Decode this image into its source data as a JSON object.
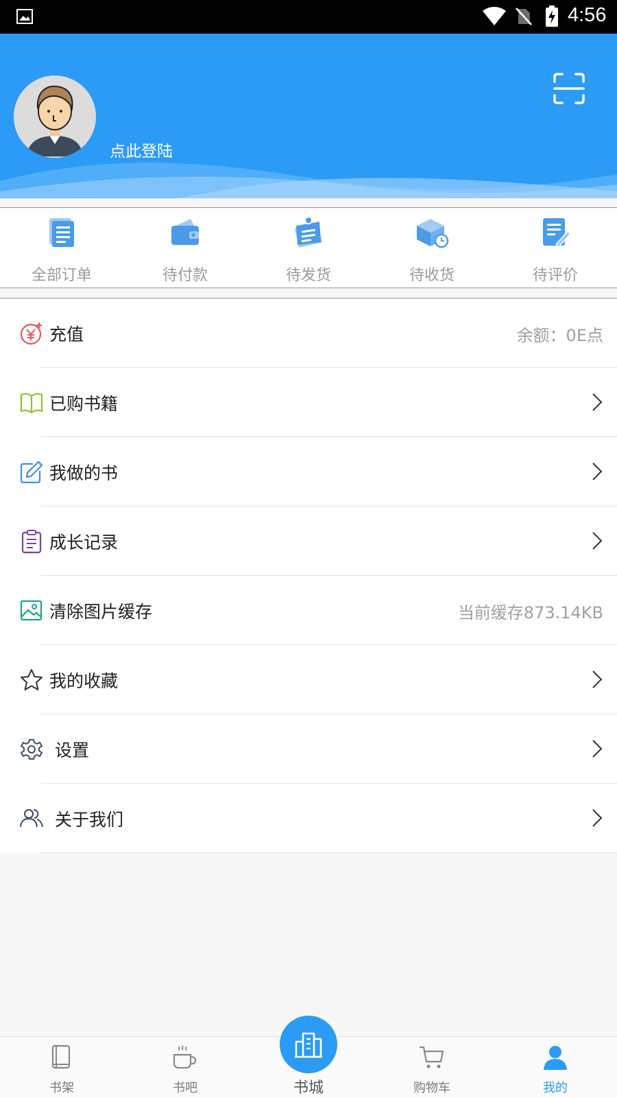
{
  "status_bar": {
    "time": "4:56"
  },
  "header": {
    "login_text": "点此登陆"
  },
  "orders": [
    {
      "label": "全部订单",
      "icon": "orders-all-icon"
    },
    {
      "label": "待付款",
      "icon": "wallet-icon"
    },
    {
      "label": "待发货",
      "icon": "ship-icon"
    },
    {
      "label": "待收货",
      "icon": "package-icon"
    },
    {
      "label": "待评价",
      "icon": "review-icon"
    }
  ],
  "menu": [
    {
      "label": "充值",
      "value": "余额：0E点",
      "icon": "yen-coin-icon"
    },
    {
      "label": "已购书籍",
      "icon": "book-open-icon"
    },
    {
      "label": "我做的书",
      "icon": "edit-icon"
    },
    {
      "label": "成长记录",
      "icon": "clipboard-icon"
    },
    {
      "label": "清除图片缓存",
      "value": "当前缓存873.14KB",
      "icon": "image-icon"
    },
    {
      "label": "我的收藏",
      "icon": "star-icon"
    },
    {
      "label": "设置",
      "icon": "gear-icon"
    },
    {
      "label": "关于我们",
      "icon": "people-icon"
    }
  ],
  "bottom_nav": [
    {
      "label": "书架",
      "icon": "bookshelf-icon"
    },
    {
      "label": "书吧",
      "icon": "coffee-icon"
    },
    {
      "label": "书城",
      "icon": "bookcity-icon"
    },
    {
      "label": "购物车",
      "icon": "cart-icon"
    },
    {
      "label": "我的",
      "icon": "user-icon"
    }
  ],
  "colors": {
    "accent": "#2b9bf5",
    "text": "#1f1f1f",
    "muted": "#9a9a9a"
  }
}
